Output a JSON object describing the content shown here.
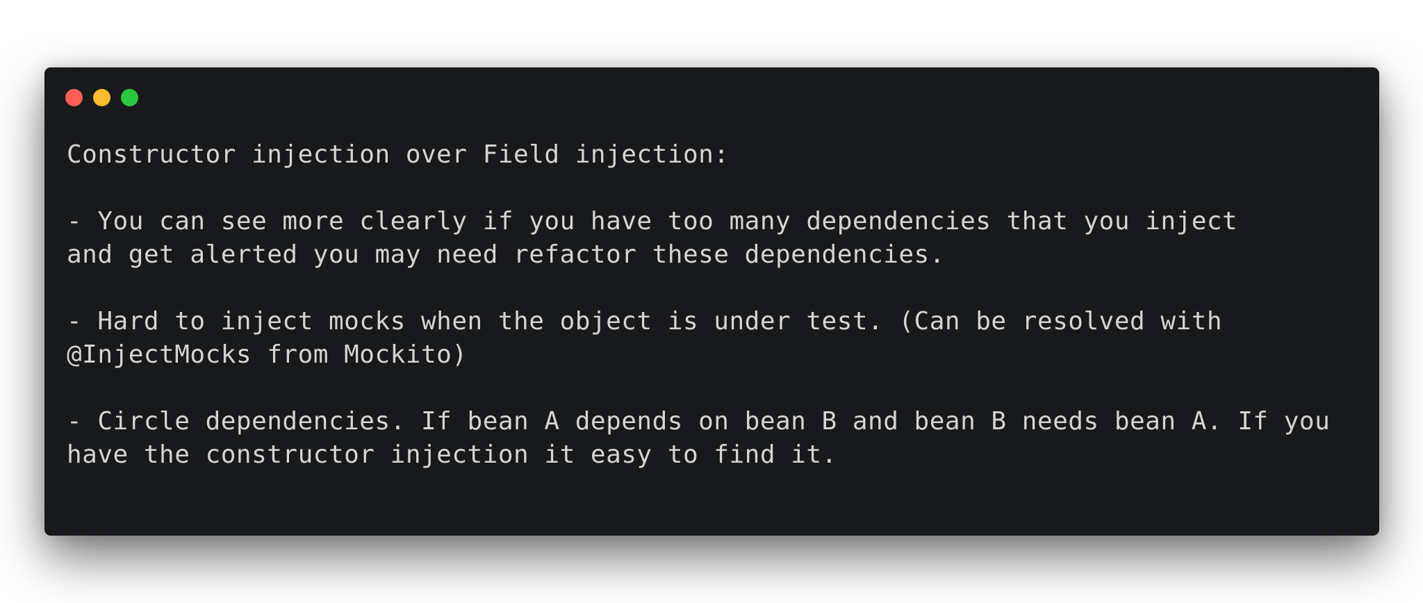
{
  "window": {
    "controls": {
      "close": {
        "icon": "close-dot-icon",
        "color": "#ff5f57"
      },
      "minimize": {
        "icon": "minimize-dot-icon",
        "color": "#febc2e"
      },
      "maximize": {
        "icon": "maximize-dot-icon",
        "color": "#28c840"
      }
    },
    "background_color": "#18191b",
    "text_color": "#d4d4d4"
  },
  "content": {
    "lines": [
      "Constructor injection over Field injection:",
      "",
      "- You can see more clearly if you have too many dependencies that you inject",
      "and get alerted you may need refactor these dependencies.",
      "",
      "- Hard to inject mocks when the object is under test. (Can be resolved with",
      "@InjectMocks from Mockito)",
      "",
      "- Circle dependencies. If bean A depends on bean B and bean B needs bean A. If you",
      "have the constructor injection it easy to find it."
    ]
  }
}
